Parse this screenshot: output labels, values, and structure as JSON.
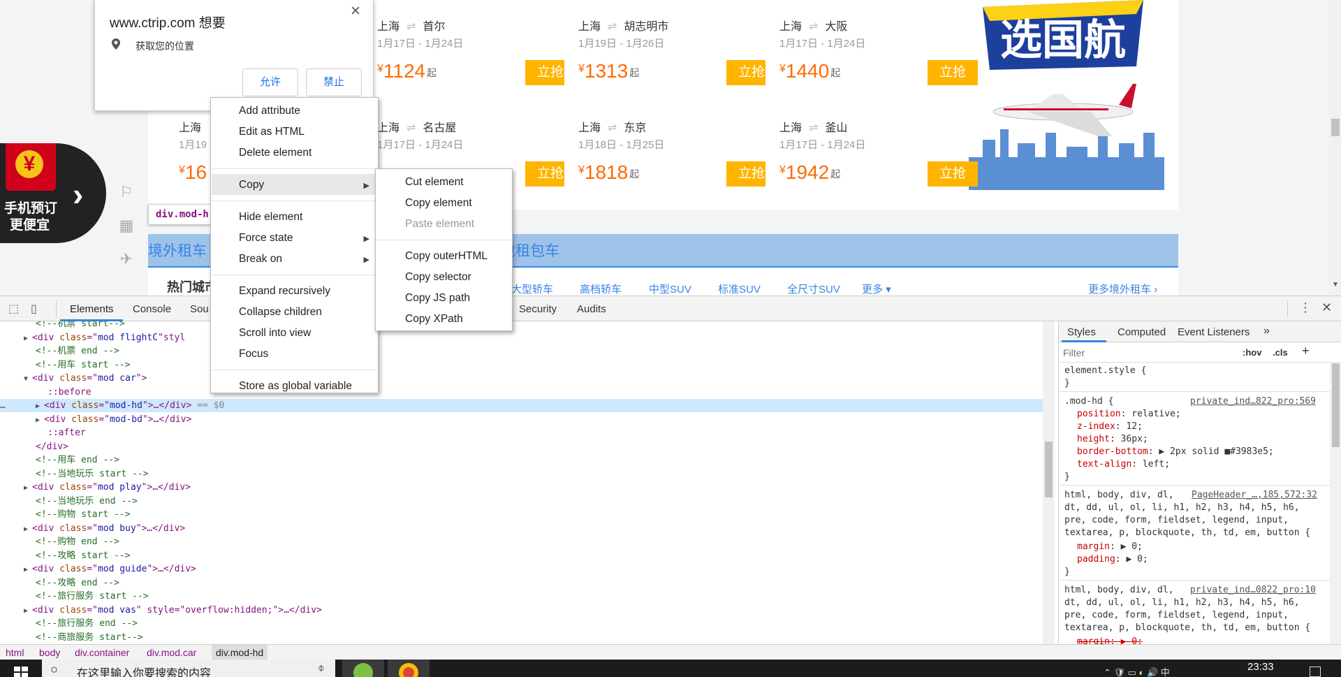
{
  "deals": [
    {
      "from": "上海",
      "to": "首尔",
      "dates": "1月17日 - 1月24日",
      "price": "1124",
      "cur": "¥",
      "qi": "起",
      "buy": "立抢"
    },
    {
      "from": "上海",
      "to": "胡志明市",
      "dates": "1月19日 - 1月26日",
      "price": "1313",
      "cur": "¥",
      "qi": "起",
      "buy": "立抢"
    },
    {
      "from": "上海",
      "to": "大阪",
      "dates": "1月17日 - 1月24日",
      "price": "1440",
      "cur": "¥",
      "qi": "起",
      "buy": "立抢"
    },
    {
      "from": "上海",
      "to": "",
      "dates": "1月19",
      "price": "16",
      "cur": "¥",
      "qi": "",
      "buy": ""
    },
    {
      "from": "上海",
      "to": "名古屋",
      "dates": "1月17日 - 1月24日",
      "price": "",
      "cur": "",
      "qi": "",
      "buy": "立抢"
    },
    {
      "from": "上海",
      "to": "东京",
      "dates": "1月18日 - 1月25日",
      "price": "1818",
      "cur": "¥",
      "qi": "起",
      "buy": "立抢"
    },
    {
      "from": "上海",
      "to": "釜山",
      "dates": "1月17日 - 1月24日",
      "price": "1942",
      "cur": "¥",
      "qi": "起",
      "buy": "立抢"
    }
  ],
  "banner": {
    "text": "选国航"
  },
  "promo": {
    "line1": "手机预订",
    "line2": "更便宜",
    "yuan": "¥"
  },
  "tooltip": {
    "text": "div.mod-h"
  },
  "car_tabs": {
    "tab1": "境外租车",
    "tab2": "包租包车"
  },
  "hot": {
    "label": "热门城市",
    "links": [
      "大型轿车",
      "高档轿车",
      "中型SUV",
      "标准SUV",
      "全尺寸SUV",
      "更多"
    ],
    "more": "更多境外租车"
  },
  "permission": {
    "site": "www.ctrip.com 想要",
    "request": "获取您的位置",
    "allow": "允许",
    "block": "禁止",
    "close": "×"
  },
  "devtools": {
    "tabs": [
      "Elements",
      "Console",
      "Sou",
      "Security",
      "Audits"
    ],
    "styles_tabs": [
      "Styles",
      "Computed",
      "Event Listeners"
    ],
    "filter_placeholder": "Filter",
    "hov": ":hov",
    "cls": ".cls",
    "code_lines": [
      {
        "indent": 6,
        "kind": "cm",
        "text": "<!--机票 start-->"
      },
      {
        "indent": 4,
        "kind": "el",
        "tri": "▶",
        "tag": "div",
        "cls": "mod flightC",
        "extra": "styl"
      },
      {
        "indent": 6,
        "kind": "cm",
        "text": "<!--机票 end -->"
      },
      {
        "indent": 6,
        "kind": "cm",
        "text": "<!--用车 start -->"
      },
      {
        "indent": 4,
        "kind": "el",
        "tri": "▼",
        "tag": "div",
        "cls": "mod car",
        "extra": ">"
      },
      {
        "indent": 8,
        "kind": "pseudo",
        "text": "::before"
      },
      {
        "indent": 6,
        "kind": "el",
        "tri": "▶",
        "tag": "div",
        "cls": "mod-hd",
        "extra": ">…</div> == $0",
        "selected": true
      },
      {
        "indent": 6,
        "kind": "el",
        "tri": "▶",
        "tag": "div",
        "cls": "mod-bd",
        "extra": ">…</div>"
      },
      {
        "indent": 8,
        "kind": "pseudo",
        "text": "::after"
      },
      {
        "indent": 6,
        "kind": "close",
        "text": "</div>"
      },
      {
        "indent": 6,
        "kind": "cm",
        "text": "<!--用车 end -->"
      },
      {
        "indent": 6,
        "kind": "cm",
        "text": "<!--当地玩乐 start -->"
      },
      {
        "indent": 4,
        "kind": "el",
        "tri": "▶",
        "tag": "div",
        "cls": "mod play",
        "extra": ">…</div>"
      },
      {
        "indent": 6,
        "kind": "cm",
        "text": "<!--当地玩乐 end -->"
      },
      {
        "indent": 6,
        "kind": "cm",
        "text": "<!--购物 start -->"
      },
      {
        "indent": 4,
        "kind": "el",
        "tri": "▶",
        "tag": "div",
        "cls": "mod buy",
        "extra": ">…</div>"
      },
      {
        "indent": 6,
        "kind": "cm",
        "text": "<!--购物 end -->"
      },
      {
        "indent": 6,
        "kind": "cm",
        "text": "<!--攻略 start -->"
      },
      {
        "indent": 4,
        "kind": "el",
        "tri": "▶",
        "tag": "div",
        "cls": "mod guide",
        "extra": ">…</div>"
      },
      {
        "indent": 6,
        "kind": "cm",
        "text": "<!--攻略 end -->"
      },
      {
        "indent": 6,
        "kind": "cm",
        "text": "<!--旅行服务 start -->"
      },
      {
        "indent": 4,
        "kind": "el",
        "tri": "▶",
        "tag": "div",
        "cls": "mod vas",
        "extra": " style=\"overflow:hidden;\">…</div>"
      },
      {
        "indent": 6,
        "kind": "cm",
        "text": "<!--旅行服务 end -->"
      },
      {
        "indent": 6,
        "kind": "cm",
        "text": "<!--商旅服务 start-->"
      }
    ],
    "styles": {
      "element_style": "element.style {",
      "rule1_selector": ".mod-hd {",
      "rule1_source": "private_ind…822_pro:569",
      "rule1_props": [
        [
          "position",
          "relative;"
        ],
        [
          "z-index",
          "12;"
        ],
        [
          "height",
          "36px;"
        ],
        [
          "border-bottom",
          "▶ 2px solid ■#3983e5;"
        ],
        [
          "text-align",
          "left;"
        ]
      ],
      "rule2_sel1": "html, body, div, dl,",
      "rule2_source": "PageHeader_…,185,572:32",
      "rule2_sel2": "dt, dd, ul, ol, li, h1, h2, h3, h4, h5, h6,",
      "rule2_sel3": "pre, code, form, fieldset, legend, input,",
      "rule2_sel4": "textarea, p, blockquote, th, td, em, button {",
      "rule2_props": [
        [
          "margin",
          "▶ 0;"
        ],
        [
          "padding",
          "▶ 0;"
        ]
      ],
      "rule3_sel1": "html, body, div, dl,",
      "rule3_source": "private_ind…0822_pro:10",
      "rule3_sel2": "dt, dd, ul, ol, li, h1, h2, h3, h4, h5, h6,",
      "rule3_sel3": "pre, code, form, fieldset, legend, input,",
      "rule3_sel4": "textarea, p, blockquote, th, td, em, button {",
      "rule3_cut": "margin: ▶ 0;",
      "brace_close": "}"
    },
    "crumbs": [
      "html",
      "body",
      "div.container",
      "div.mod.car",
      "div.mod-hd"
    ]
  },
  "context_menu": {
    "items": [
      "Add attribute",
      "Edit as HTML",
      "Delete element",
      "Copy",
      "Hide element",
      "Force state",
      "Break on",
      "Expand recursively",
      "Collapse children",
      "Scroll into view",
      "Focus",
      "Store as global variable"
    ]
  },
  "copy_menu": {
    "items": [
      "Cut element",
      "Copy element",
      "Paste element",
      "Copy outerHTML",
      "Copy selector",
      "Copy JS path",
      "Copy XPath"
    ]
  },
  "taskbar": {
    "search": "在这里输入你要搜索的内容",
    "time": "23:33",
    "ime": "中"
  }
}
